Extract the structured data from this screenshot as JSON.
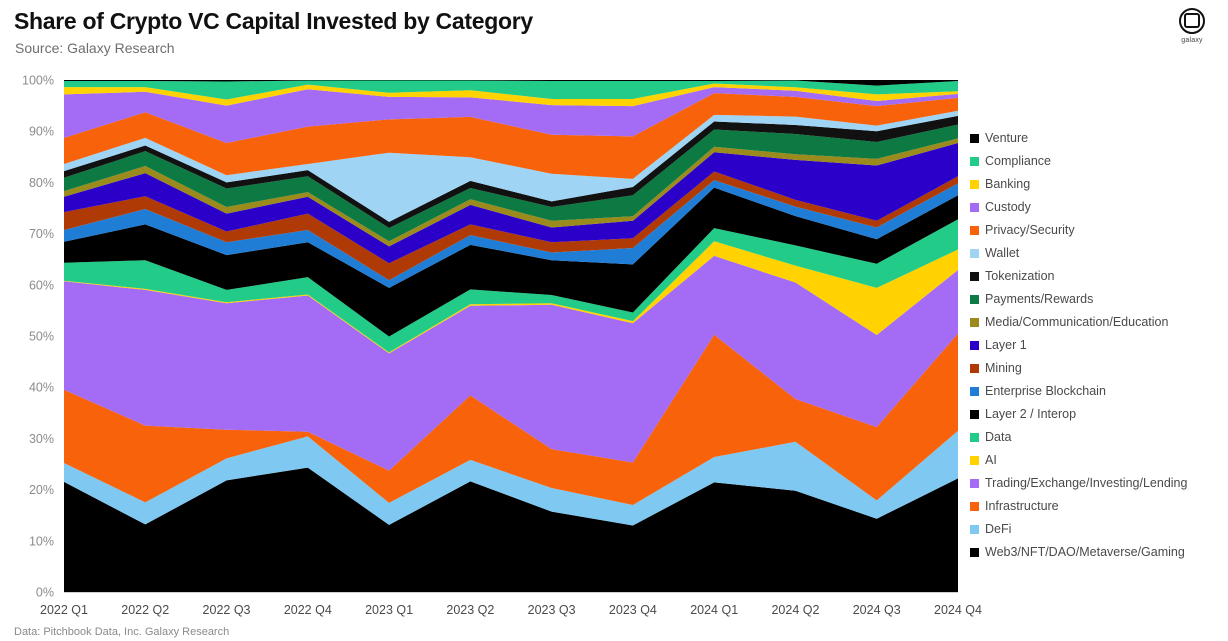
{
  "header": {
    "title": "Share of Crypto VC Capital Invested by Category",
    "subtitle": "Source: Galaxy Research",
    "logo_text": "galaxy",
    "logo_icon": "galaxy-logo-icon"
  },
  "footer": {
    "note": "Data: Pitchbook Data, Inc. Galaxy Research"
  },
  "chart_data": {
    "type": "area",
    "stacked": true,
    "stack_order": "bottom-to-top",
    "title": "Share of Crypto VC Capital Invested by Category",
    "subtitle": "Source: Galaxy Research",
    "xlabel": "",
    "ylabel": "",
    "ylim": [
      0,
      100
    ],
    "yticks": [
      0,
      10,
      20,
      30,
      40,
      50,
      60,
      70,
      80,
      90,
      100
    ],
    "ytick_labels": [
      "0%",
      "10%",
      "20%",
      "30%",
      "40%",
      "50%",
      "60%",
      "70%",
      "80%",
      "90%",
      "100%"
    ],
    "grid": false,
    "legend_position": "right",
    "categories": [
      "2022 Q1",
      "2022 Q2",
      "2022 Q3",
      "2022 Q4",
      "2023 Q1",
      "2023 Q2",
      "2023 Q3",
      "2023 Q4",
      "2024 Q1",
      "2024 Q2",
      "2024 Q3",
      "2024 Q4"
    ],
    "series": [
      {
        "name": "Web3/NFT/DAO/Metaverse/Gaming",
        "color": "#000000",
        "values": [
          21.5,
          13.2,
          21.8,
          24.3,
          13.1,
          21.6,
          15.7,
          13.0,
          21.7,
          18.0,
          14.3,
          22.2
        ]
      },
      {
        "name": "DeFi",
        "color": "#7EC8F2",
        "values": [
          3.7,
          4.3,
          4.3,
          6.1,
          4.3,
          4.2,
          4.6,
          4.0,
          5.0,
          8.7,
          3.6,
          9.3
        ]
      },
      {
        "name": "Infrastructure",
        "color": "#F8620B",
        "values": [
          14.3,
          15.0,
          5.6,
          0.9,
          6.3,
          12.6,
          7.6,
          8.3,
          24.2,
          7.6,
          14.3,
          19.0
        ]
      },
      {
        "name": "Trading/Exchange/Investing/Lending",
        "color": "#A46BF5",
        "values": [
          21.2,
          26.5,
          24.7,
          26.6,
          22.9,
          17.5,
          28.2,
          27.2,
          15.6,
          20.7,
          18.0,
          12.4
        ]
      },
      {
        "name": "AI",
        "color": "#FFD200",
        "values": [
          0.1,
          0.2,
          0.2,
          0.2,
          0.2,
          0.3,
          0.3,
          0.4,
          2.9,
          3.0,
          9.2,
          4.0
        ]
      },
      {
        "name": "Data",
        "color": "#22CC88",
        "values": [
          3.5,
          5.6,
          2.4,
          3.4,
          3.1,
          2.9,
          1.6,
          1.7,
          2.6,
          3.6,
          4.7,
          5.9
        ]
      },
      {
        "name": "Layer 2 / Interop",
        "color": "#000000",
        "values": [
          4.1,
          7.0,
          6.8,
          6.8,
          9.5,
          8.7,
          6.8,
          9.4,
          8.0,
          5.2,
          4.8,
          4.7
        ]
      },
      {
        "name": "Enterprise Blockchain",
        "color": "#1F7DD6",
        "values": [
          2.3,
          3.0,
          2.5,
          2.4,
          1.5,
          1.9,
          1.5,
          3.2,
          1.5,
          1.7,
          2.3,
          2.3
        ]
      },
      {
        "name": "Mining",
        "color": "#B03A06",
        "values": [
          3.5,
          2.5,
          2.1,
          3.2,
          3.3,
          2.1,
          2.0,
          1.9,
          1.7,
          1.2,
          1.3,
          1.4
        ]
      },
      {
        "name": "Layer 1",
        "color": "#2B00C8",
        "values": [
          3.0,
          4.5,
          3.5,
          3.3,
          3.3,
          3.8,
          2.9,
          3.4,
          3.8,
          7.1,
          10.8,
          6.5
        ]
      },
      {
        "name": "Media/Communication/Education",
        "color": "#9B8A1C",
        "values": [
          1.1,
          1.4,
          1.3,
          0.9,
          1.0,
          1.1,
          1.3,
          0.9,
          1.1,
          1.0,
          1.3,
          0.9
        ]
      },
      {
        "name": "Payments/Rewards",
        "color": "#0E7A43",
        "values": [
          2.6,
          2.9,
          3.6,
          3.1,
          2.6,
          2.2,
          2.7,
          4.1,
          3.4,
          3.6,
          3.3,
          2.7
        ]
      },
      {
        "name": "Tokenization",
        "color": "#111111",
        "values": [
          1.3,
          1.1,
          1.2,
          1.2,
          1.2,
          1.4,
          1.1,
          1.6,
          1.6,
          1.6,
          2.1,
          1.7
        ]
      },
      {
        "name": "Wallet",
        "color": "#9FD4F5",
        "values": [
          1.4,
          1.5,
          1.4,
          1.2,
          13.5,
          4.6,
          5.4,
          1.6,
          1.3,
          1.5,
          1.1,
          1.0
        ]
      },
      {
        "name": "Privacy/Security",
        "color": "#F8620B",
        "values": [
          5.1,
          5.0,
          6.3,
          7.3,
          6.5,
          7.9,
          7.6,
          8.3,
          4.3,
          3.5,
          3.8,
          2.5
        ]
      },
      {
        "name": "Custody",
        "color": "#A46BF5",
        "values": [
          8.5,
          4.0,
          7.3,
          7.3,
          4.4,
          3.8,
          5.8,
          5.9,
          1.2,
          1.1,
          1.0,
          0.8
        ]
      },
      {
        "name": "Banking",
        "color": "#FFD200",
        "values": [
          1.4,
          0.9,
          1.2,
          0.9,
          0.8,
          1.4,
          1.2,
          1.4,
          0.7,
          0.6,
          1.3,
          0.5
        ]
      },
      {
        "name": "Compliance",
        "color": "#22CC88",
        "values": [
          1.2,
          1.2,
          3.5,
          0.8,
          2.4,
          1.9,
          3.5,
          3.5,
          0.5,
          1.2,
          1.7,
          2.0
        ]
      },
      {
        "name": "Venture",
        "color": "#000000",
        "values": [
          0.2,
          0.2,
          0.3,
          0.1,
          0.1,
          0.1,
          0.2,
          0.2,
          0.2,
          0.1,
          1.1,
          0.2
        ]
      }
    ]
  },
  "legend": {
    "items": [
      {
        "label": "Venture",
        "color": "#000000"
      },
      {
        "label": "Compliance",
        "color": "#22CC88"
      },
      {
        "label": "Banking",
        "color": "#FFD200"
      },
      {
        "label": "Custody",
        "color": "#A46BF5"
      },
      {
        "label": "Privacy/Security",
        "color": "#F8620B"
      },
      {
        "label": "Wallet",
        "color": "#9FD4F5"
      },
      {
        "label": "Tokenization",
        "color": "#111111"
      },
      {
        "label": "Payments/Rewards",
        "color": "#0E7A43"
      },
      {
        "label": "Media/Communication/Education",
        "color": "#9B8A1C"
      },
      {
        "label": "Layer 1",
        "color": "#2B00C8"
      },
      {
        "label": "Mining",
        "color": "#B03A06"
      },
      {
        "label": "Enterprise Blockchain",
        "color": "#1F7DD6"
      },
      {
        "label": "Layer 2 / Interop",
        "color": "#000000"
      },
      {
        "label": "Data",
        "color": "#22CC88"
      },
      {
        "label": "AI",
        "color": "#FFD200"
      },
      {
        "label": "Trading/Exchange/Investing/Lending",
        "color": "#A46BF5"
      },
      {
        "label": "Infrastructure",
        "color": "#F8620B"
      },
      {
        "label": "DeFi",
        "color": "#7EC8F2"
      },
      {
        "label": "Web3/NFT/DAO/Metaverse/Gaming",
        "color": "#000000"
      }
    ]
  }
}
